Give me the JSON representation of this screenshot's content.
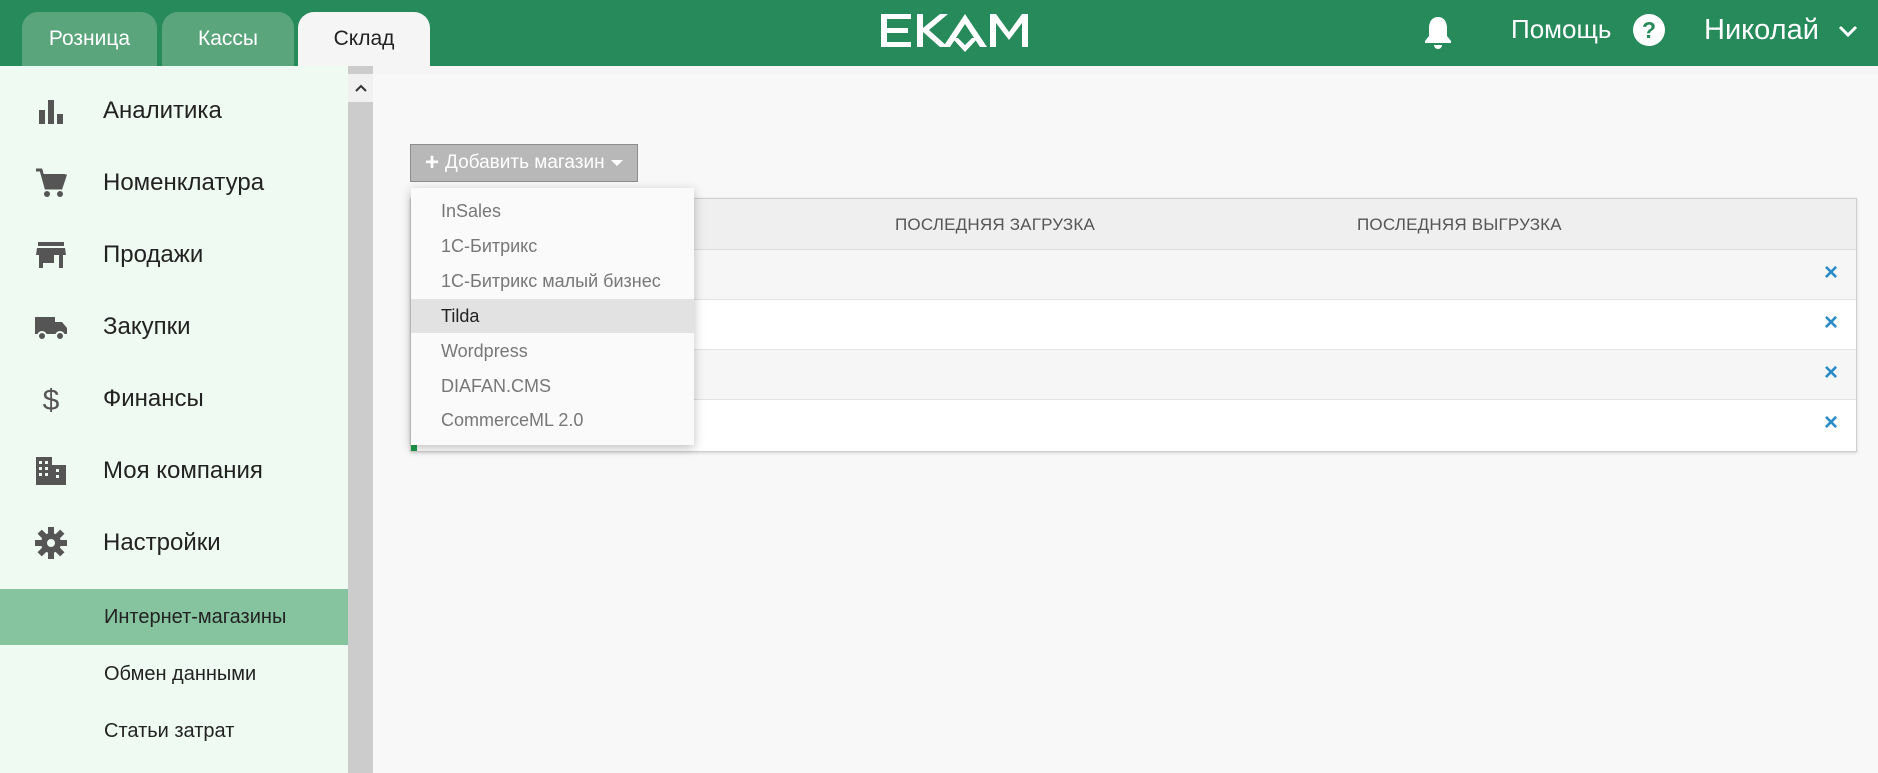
{
  "topbar": {
    "tabs": [
      {
        "label": "Розница",
        "active": false
      },
      {
        "label": "Кассы",
        "active": false
      },
      {
        "label": "Склад",
        "active": true
      }
    ],
    "logo": "EKAM",
    "help_label": "Помощь",
    "help_icon": "?",
    "user_name": "Николай"
  },
  "sidebar": {
    "items": [
      {
        "label": "Аналитика",
        "icon": "bar-chart-icon"
      },
      {
        "label": "Номенклатура",
        "icon": "cart-icon"
      },
      {
        "label": "Продажи",
        "icon": "store-icon"
      },
      {
        "label": "Закупки",
        "icon": "truck-icon"
      },
      {
        "label": "Финансы",
        "icon": "dollar-icon"
      },
      {
        "label": "Моя компания",
        "icon": "building-icon"
      },
      {
        "label": "Настройки",
        "icon": "gear-icon"
      }
    ],
    "sub_items": [
      {
        "label": "Интернет-магазины",
        "active": true
      },
      {
        "label": "Обмен данными",
        "active": false
      },
      {
        "label": "Статьи затрат",
        "active": false
      }
    ]
  },
  "main": {
    "add_button": {
      "plus": "+",
      "label": "Добавить магазин"
    },
    "table": {
      "headers": [
        "ПОСЛЕДНЯЯ ЗАГРУЗКА",
        "ПОСЛЕДНЯЯ ВЫГРУЗКА"
      ],
      "delete_glyph": "×"
    },
    "dropdown": {
      "options": [
        "InSales",
        "1С-Битрикс",
        "1С-Битрикс малый бизнес",
        "Tilda",
        "Wordpress",
        "DIAFAN.CMS",
        "CommerceML 2.0"
      ],
      "highlighted": "Tilda"
    }
  },
  "colors": {
    "brand": "#268a5a",
    "sidebar_bg": "#eefaf2",
    "active_sub": "#86c4a0",
    "delete": "#2a8cc7"
  }
}
